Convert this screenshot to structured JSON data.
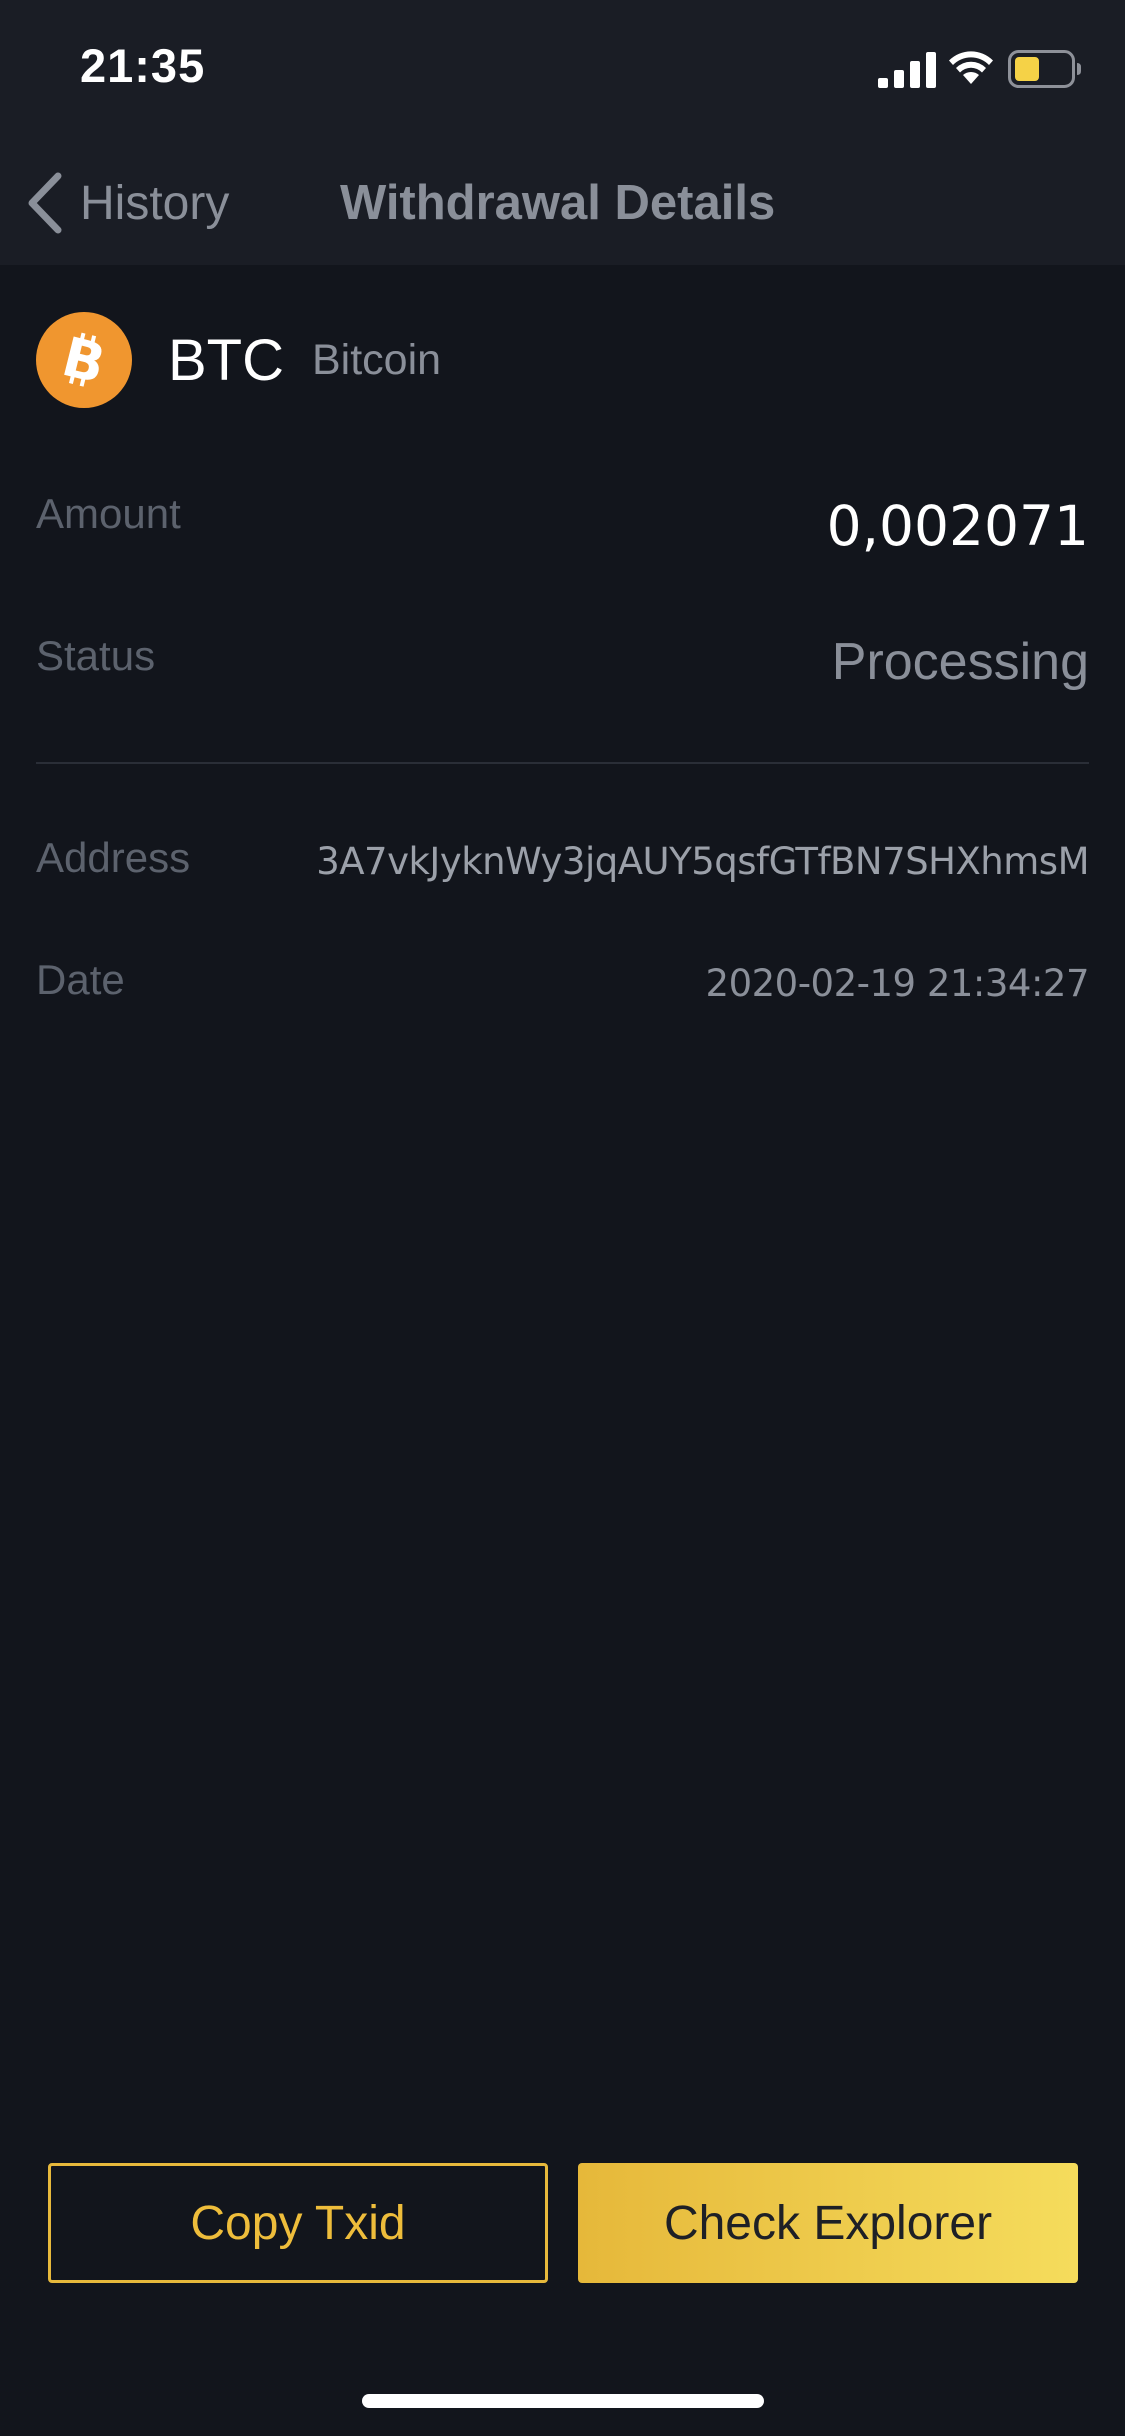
{
  "status_bar": {
    "time": "21:35",
    "icons": [
      "signal-icon",
      "wifi-icon",
      "battery-icon"
    ],
    "battery_color": "#f5d247"
  },
  "nav": {
    "back_label": "History",
    "title": "Withdrawal Details"
  },
  "coin": {
    "symbol": "BTC",
    "name": "Bitcoin",
    "logo_icon": "bitcoin-logo-icon",
    "logo_color": "#f0962f"
  },
  "details": {
    "amount_label": "Amount",
    "amount_value": "0,002071",
    "status_label": "Status",
    "status_value": "Processing",
    "address_label": "Address",
    "address_value": "3A7vkJyknWy3jqAUY5qsfGTfBN7SHXhmsM",
    "date_label": "Date",
    "date_value": "2020-02-19 21:34:27"
  },
  "buttons": {
    "copy_txid": "Copy Txid",
    "check_explorer": "Check Explorer"
  },
  "colors": {
    "background": "#12151c",
    "accent": "#eebd3b"
  }
}
